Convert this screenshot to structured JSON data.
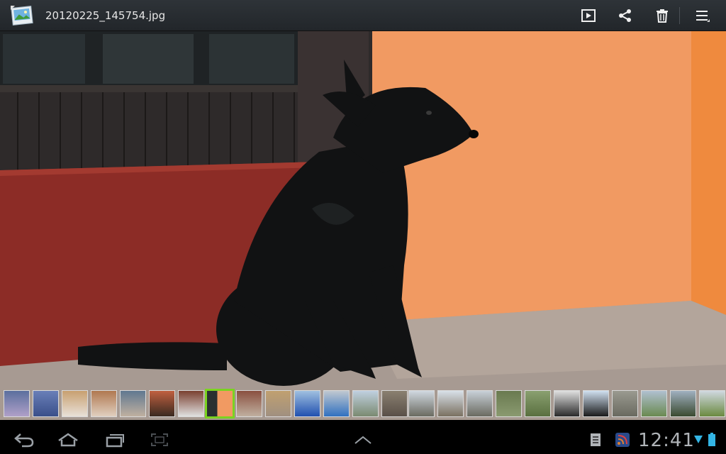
{
  "actionbar": {
    "app_icon": "gallery-photo-icon",
    "file_name": "20120225_145754.jpg",
    "actions": [
      {
        "name": "slideshow-play-icon"
      },
      {
        "name": "share-icon"
      },
      {
        "name": "delete-trash-icon"
      },
      {
        "name": "overflow-menu-icon"
      }
    ]
  },
  "photo": {
    "subject": "black dog sitting against orange wall"
  },
  "filmstrip": {
    "selected_index": 7,
    "thumbnail_count": 25
  },
  "systembar": {
    "clock": "12:41",
    "buttons": [
      "back-icon",
      "home-icon",
      "recent-apps-icon",
      "screenshot-icon",
      "expand-up-icon"
    ],
    "status_icons": [
      "notification-clipboard-icon",
      "rss-feed-icon",
      "wifi-icon",
      "battery-icon"
    ]
  },
  "colors": {
    "actionbar_bg": "#2b3035",
    "selected_thumb": "#7bd320",
    "wall_orange": "#f19a62",
    "door_red": "#8c2c26"
  }
}
